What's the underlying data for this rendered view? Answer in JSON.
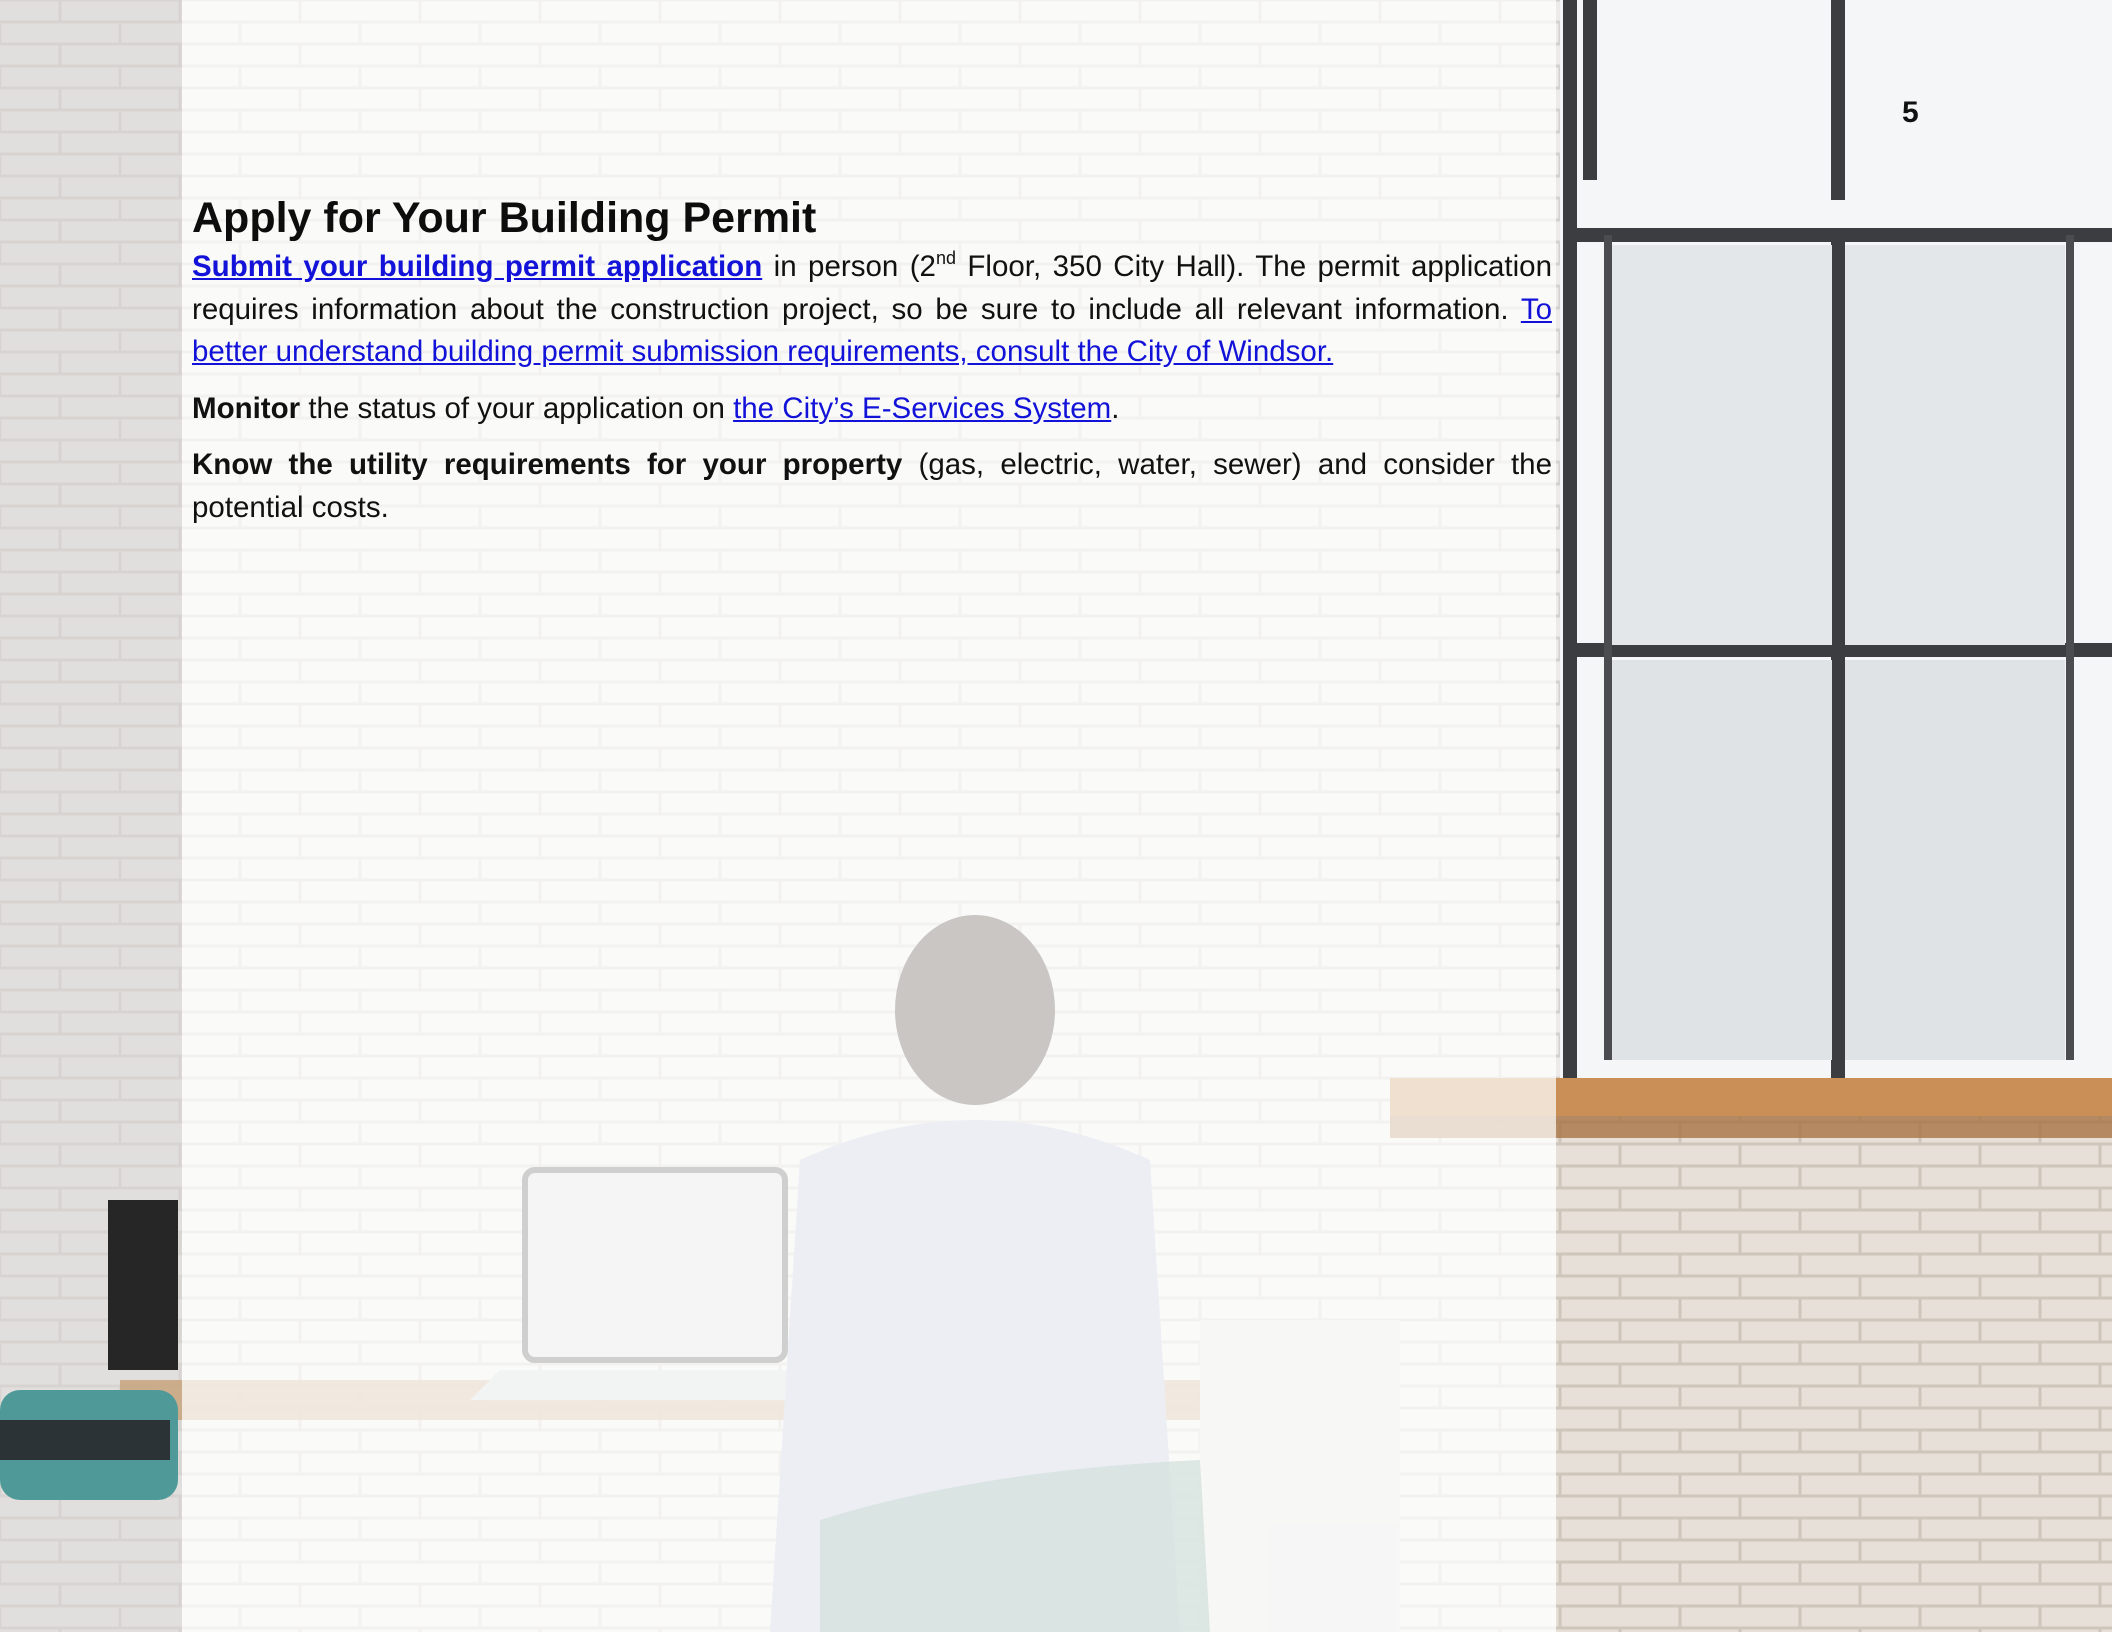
{
  "page_number": "5",
  "title": "Apply for Your Building Permit",
  "p1": {
    "link1": "Submit your building permit application",
    "t1": " in person (2",
    "sup": "nd",
    "t2": " Floor, 350 City Hall). The permit application requires information about the construction project, so be sure to include all relevant information. ",
    "link2": "To better understand building permit submission requirements, consult the City of Windsor."
  },
  "p2": {
    "bold": "Monitor",
    "t1": " the status of your application on ",
    "link": "the City’s E-Services System",
    "t2": "."
  },
  "p3": {
    "bold": "Know the utility requirements for your property",
    "t1": " (gas, electric, water, sewer) and consider the potential costs."
  },
  "colors": {
    "link": "#1212d8",
    "text": "#111111"
  },
  "background_image": "office-window-person-at-laptop-photo"
}
